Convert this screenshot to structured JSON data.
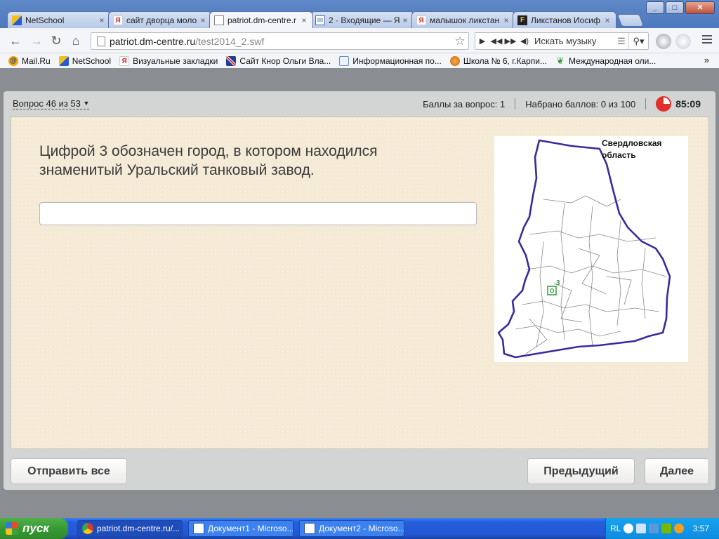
{
  "browser": {
    "tabs": [
      {
        "label": "NetSchool",
        "favicon": "netschool-icon",
        "active": false
      },
      {
        "label": "сайт дворца моло",
        "favicon": "yandex-icon",
        "active": false
      },
      {
        "label": "patriot.dm-centre.r",
        "favicon": "page-icon",
        "active": true
      },
      {
        "label": "2 · Входящие — Я",
        "favicon": "mail-icon",
        "active": false
      },
      {
        "label": "малышок ликстан",
        "favicon": "yandex-icon",
        "active": false
      },
      {
        "label": "Ликстанов Иосиф",
        "favicon": "fr-icon",
        "active": false
      }
    ],
    "url_host": "patriot.dm-centre.ru",
    "url_path": "/test2014_2.swf",
    "music_placeholder": "Искать музыку",
    "bookmarks": [
      {
        "label": "Mail.Ru",
        "icon": "mailru-icon",
        "color": "#f7a600"
      },
      {
        "label": "NetSchool",
        "icon": "netschool-icon",
        "color": "#f0c020"
      },
      {
        "label": "Визуальные закладки",
        "icon": "yandex-icon",
        "color": "#e02020"
      },
      {
        "label": "Сайт Кнор Ольги Вла...",
        "icon": "uk-flag-icon",
        "color": "#1f3f8f"
      },
      {
        "label": "Информационная по...",
        "icon": "doc-icon",
        "color": "#6a8fc8"
      },
      {
        "label": "Школа № 6, г.Карпи...",
        "icon": "firefox-icon",
        "color": "#e07a20"
      },
      {
        "label": "Международная оли...",
        "icon": "leaf-icon",
        "color": "#3a9a3a"
      }
    ],
    "bookmarks_more": "»"
  },
  "quiz": {
    "question_counter": "Вопрос 46 из 53",
    "points_per_question": "Баллы за вопрос: 1",
    "points_total": "Набрано баллов: 0 из 100",
    "timer": "85:09",
    "question_text_line1": "Цифрой 3 обозначен город, в котором находился",
    "question_text_line2": "знаменитый Уральский танковый завод.",
    "answer_value": "",
    "map": {
      "title_line1": "Свердловская",
      "title_line2": "область",
      "marker_label": "3"
    },
    "buttons": {
      "submit_all": "Отправить все",
      "previous": "Предыдущий",
      "next": "Далее"
    }
  },
  "taskbar": {
    "start_label": "пуск",
    "tasks": [
      {
        "label": "patriot.dm-centre.ru/...",
        "icon": "chrome-icon"
      },
      {
        "label": "Документ1 - Microso...",
        "icon": "word-icon"
      },
      {
        "label": "Документ2 - Microso...",
        "icon": "word-icon"
      }
    ],
    "language": "RL",
    "clock": "3:57"
  },
  "colors": {
    "accent_blue": "#245edb",
    "map_border": "#3b2a9e",
    "timer_red": "#e0302a",
    "card_bg": "#f4ead6"
  }
}
